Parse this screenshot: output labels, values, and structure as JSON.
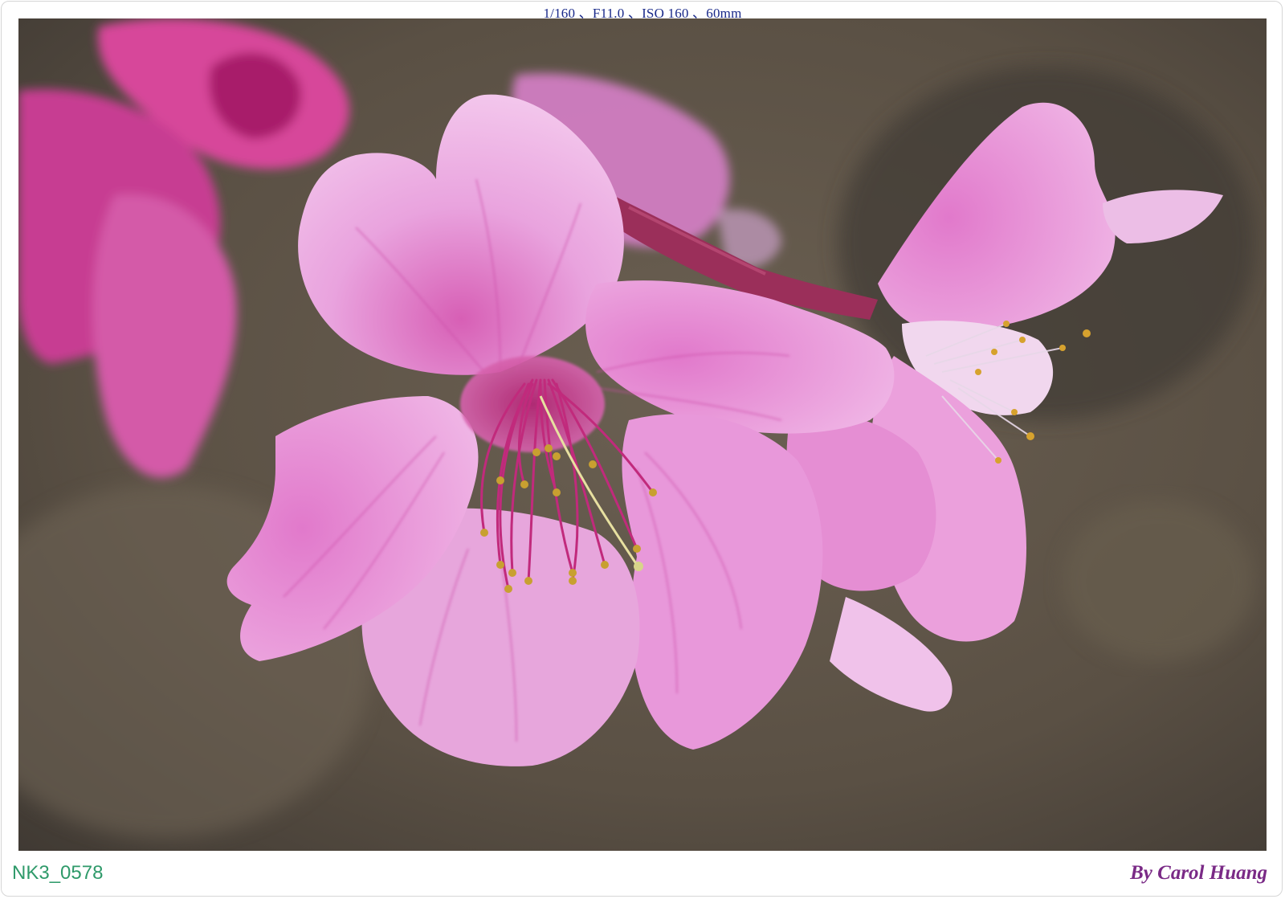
{
  "caption": {
    "exif": "1/160 、F11.0 、ISO 160 、60mm",
    "filename": "NK3_0578",
    "signature": "By Carol Huang"
  },
  "photo": {
    "subject": "pink-cherry-blossom",
    "colors": {
      "petal_light": "#f0b8e6",
      "petal_mid": "#e28fd6",
      "petal_deep": "#c2348f",
      "stamen": "#c12a7c",
      "anther": "#c8a030",
      "background": "#5a4f45"
    }
  }
}
